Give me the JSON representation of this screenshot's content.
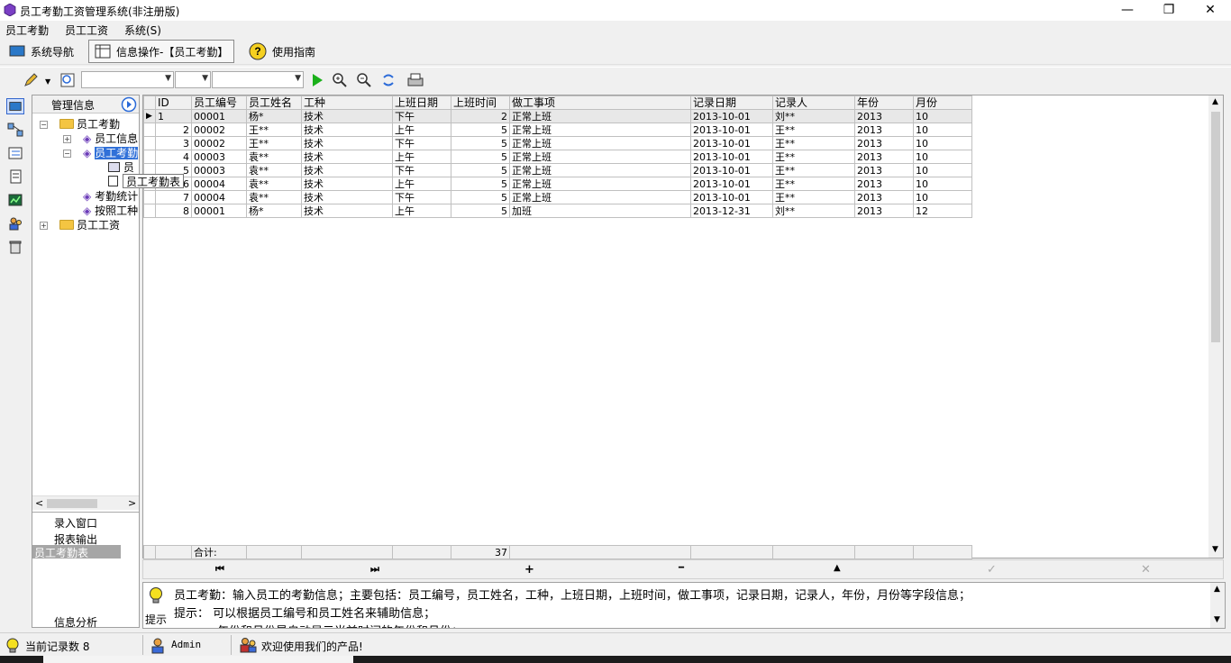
{
  "window": {
    "title": "员工考勤工资管理系统(非注册版)",
    "min_symbol": "—",
    "restore_symbol": "❐",
    "close_symbol": "✕"
  },
  "menu": [
    "员工考勤",
    "员工工资",
    "系统(S)"
  ],
  "nav_tabs": [
    "系统导航",
    "信息操作-【员工考勤】",
    "使用指南"
  ],
  "tree": {
    "header": "管理信息",
    "nodes": [
      "员工考勤",
      "员工信息",
      "员工考勤",
      "员",
      "员工考勤表",
      "考勤统计",
      "按照工种",
      "员工工资"
    ],
    "tooltip": "员工考勤表"
  },
  "left_menu": {
    "items": [
      "录入窗口",
      "报表输出",
      "员工考勤表"
    ],
    "bottom": "信息分析"
  },
  "grid": {
    "columns": [
      "ID",
      "员工编号",
      "员工姓名",
      "工种",
      "上班日期",
      "上班时间",
      "做工事项",
      "记录日期",
      "记录人",
      "年份",
      "月份"
    ],
    "rows": [
      [
        "1",
        "00001",
        "杨*",
        "技术",
        "下午",
        "2",
        "正常上班",
        "2013-10-01",
        "刘**",
        "2013",
        "10"
      ],
      [
        "2",
        "00002",
        "王**",
        "技术",
        "上午",
        "5",
        "正常上班",
        "2013-10-01",
        "王**",
        "2013",
        "10"
      ],
      [
        "3",
        "00002",
        "王**",
        "技术",
        "下午",
        "5",
        "正常上班",
        "2013-10-01",
        "王**",
        "2013",
        "10"
      ],
      [
        "4",
        "00003",
        "袁**",
        "技术",
        "上午",
        "5",
        "正常上班",
        "2013-10-01",
        "王**",
        "2013",
        "10"
      ],
      [
        "5",
        "00003",
        "袁**",
        "技术",
        "下午",
        "5",
        "正常上班",
        "2013-10-01",
        "王**",
        "2013",
        "10"
      ],
      [
        "6",
        "00004",
        "袁**",
        "技术",
        "上午",
        "5",
        "正常上班",
        "2013-10-01",
        "王**",
        "2013",
        "10"
      ],
      [
        "7",
        "00004",
        "袁**",
        "技术",
        "下午",
        "5",
        "正常上班",
        "2013-10-01",
        "王**",
        "2013",
        "10"
      ],
      [
        "8",
        "00001",
        "杨*",
        "技术",
        "上午",
        "5",
        "加班",
        "2013-12-31",
        "刘**",
        "2013",
        "12"
      ]
    ],
    "footer_label": "合计:",
    "footer_total": "37"
  },
  "nav_buttons": {
    "first": "⏮",
    "last": "⏭",
    "add": "+",
    "delete": "━",
    "up": "▲",
    "check": "✓",
    "cancel": "✕"
  },
  "hint": {
    "label": "提示",
    "line1": "员工考勤：输入员工的考勤信息；主要包括：员工编号，员工姓名，工种，上班日期，上班时间，做工事项，记录日期，记录人，年份，月份等字段信息；",
    "line2": "提示： 可以根据员工编号和员工姓名来辅助信息；",
    "line3": "年份和月份是自动显示当前时间的年份和月份；"
  },
  "status": {
    "records": "当前记录数 8",
    "user": "Admin",
    "welcome": "欢迎使用我们的产品!"
  }
}
